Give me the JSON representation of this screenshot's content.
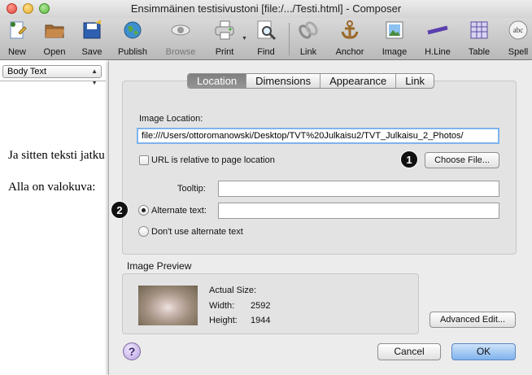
{
  "window": {
    "title": "Ensimmäinen testisivustoni [file:/.../Testi.html] - Composer"
  },
  "toolbar": {
    "items": [
      {
        "label": "New",
        "icon": "new-page-icon"
      },
      {
        "label": "Open",
        "icon": "folder-icon"
      },
      {
        "label": "Save",
        "icon": "save-disk-icon"
      },
      {
        "label": "Publish",
        "icon": "globe-icon"
      },
      {
        "label": "Browse",
        "icon": "eye-icon",
        "disabled": true
      },
      {
        "label": "Print",
        "icon": "printer-icon"
      },
      {
        "label": "Find",
        "icon": "magnifier-icon"
      },
      {
        "label": "Link",
        "icon": "chain-link-icon"
      },
      {
        "label": "Anchor",
        "icon": "anchor-icon"
      },
      {
        "label": "Image",
        "icon": "picture-icon"
      },
      {
        "label": "H.Line",
        "icon": "horizontal-line-icon"
      },
      {
        "label": "Table",
        "icon": "table-grid-icon"
      },
      {
        "label": "Spell",
        "icon": "spell-check-icon"
      }
    ]
  },
  "editor": {
    "paragraph_style": "Body Text",
    "lines": [
      "Ja sitten teksti jatku",
      "Alla on valokuva:"
    ]
  },
  "dialog": {
    "tabs": [
      "Location",
      "Dimensions",
      "Appearance",
      "Link"
    ],
    "selected_tab": "Location",
    "image_location_label": "Image Location:",
    "image_location_value": "file:///Users/ottoromanowski/Desktop/TVT%20Julkaisu2/TVT_Julkaisu_2_Photos/",
    "relative_url_label": "URL is relative to page location",
    "choose_file_label": "Choose File...",
    "tooltip_label": "Tooltip:",
    "tooltip_value": "",
    "alternate_text_label": "Alternate text:",
    "alternate_text_value": "",
    "no_alternate_label": "Don't use alternate text",
    "preview_title": "Image Preview",
    "actual_size_label": "Actual Size:",
    "width_label": "Width:",
    "width_value": "2592",
    "height_label": "Height:",
    "height_value": "1944",
    "advanced_edit_label": "Advanced Edit...",
    "cancel_label": "Cancel",
    "ok_label": "OK",
    "help_glyph": "?",
    "callouts": [
      "1",
      "2"
    ]
  },
  "colors": {
    "ok_button": "#7fb3ec",
    "selected_tab": "#8a8a8a",
    "callout": "#111111"
  }
}
